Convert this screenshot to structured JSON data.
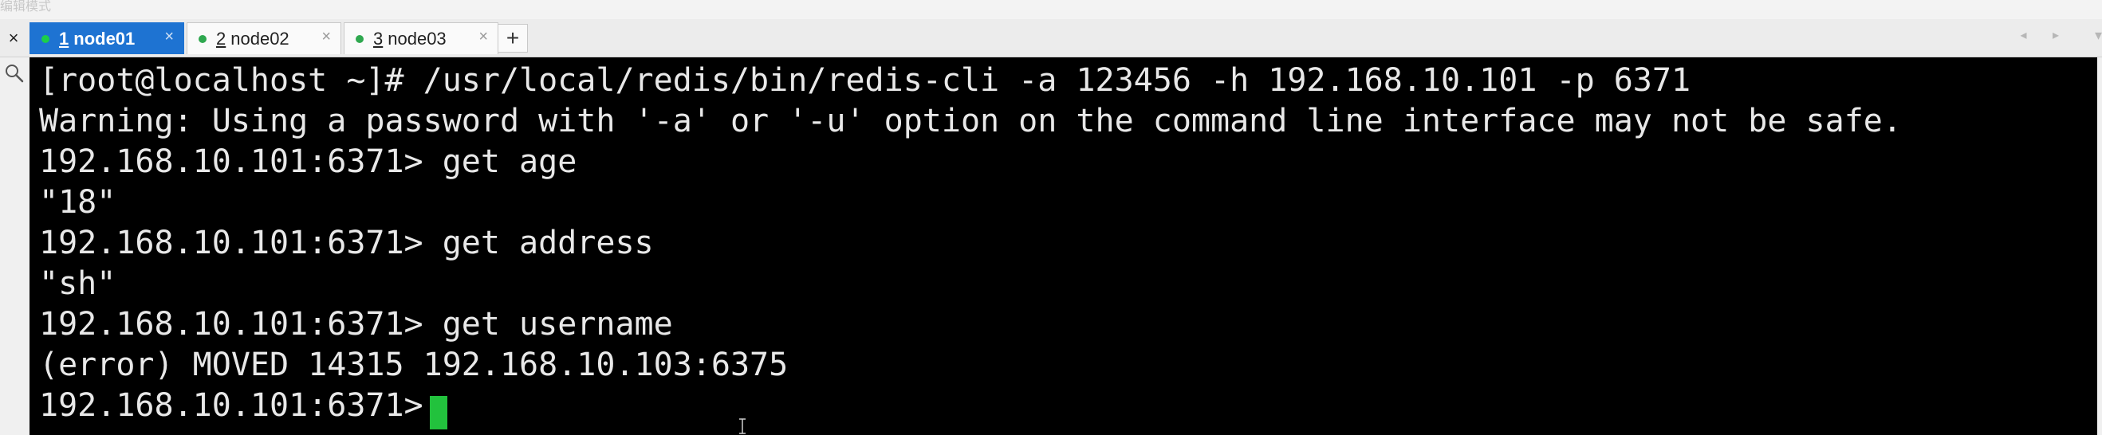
{
  "top_strip": {
    "ghost_text": "编辑模式"
  },
  "tabbar": {
    "close_all_label": "×",
    "tabs": [
      {
        "number": "1",
        "name": "node01",
        "active": true,
        "close": "×"
      },
      {
        "number": "2",
        "name": "node02",
        "active": false,
        "close": "×"
      },
      {
        "number": "3",
        "name": "node03",
        "active": false,
        "close": "×"
      }
    ],
    "new_tab_label": "+",
    "scroll_arrows": "◂ ▸",
    "menu_icon": "▾"
  },
  "terminal": {
    "lines": [
      "[root@localhost ~]# /usr/local/redis/bin/redis-cli -a 123456 -h 192.168.10.101 -p 6371",
      "Warning: Using a password with '-a' or '-u' option on the command line interface may not be safe.",
      "192.168.10.101:6371> get age",
      "\"18\"",
      "192.168.10.101:6371> get address",
      "\"sh\"",
      "192.168.10.101:6371> get username",
      "(error) MOVED 14315 192.168.10.103:6375",
      "192.168.10.101:6371> "
    ],
    "cursor_color": "#22c23d"
  },
  "colors": {
    "active_tab": "#1e73d2",
    "status_dot": "#2fa84f",
    "terminal_bg": "#000000",
    "terminal_fg": "#e8e8e8"
  }
}
